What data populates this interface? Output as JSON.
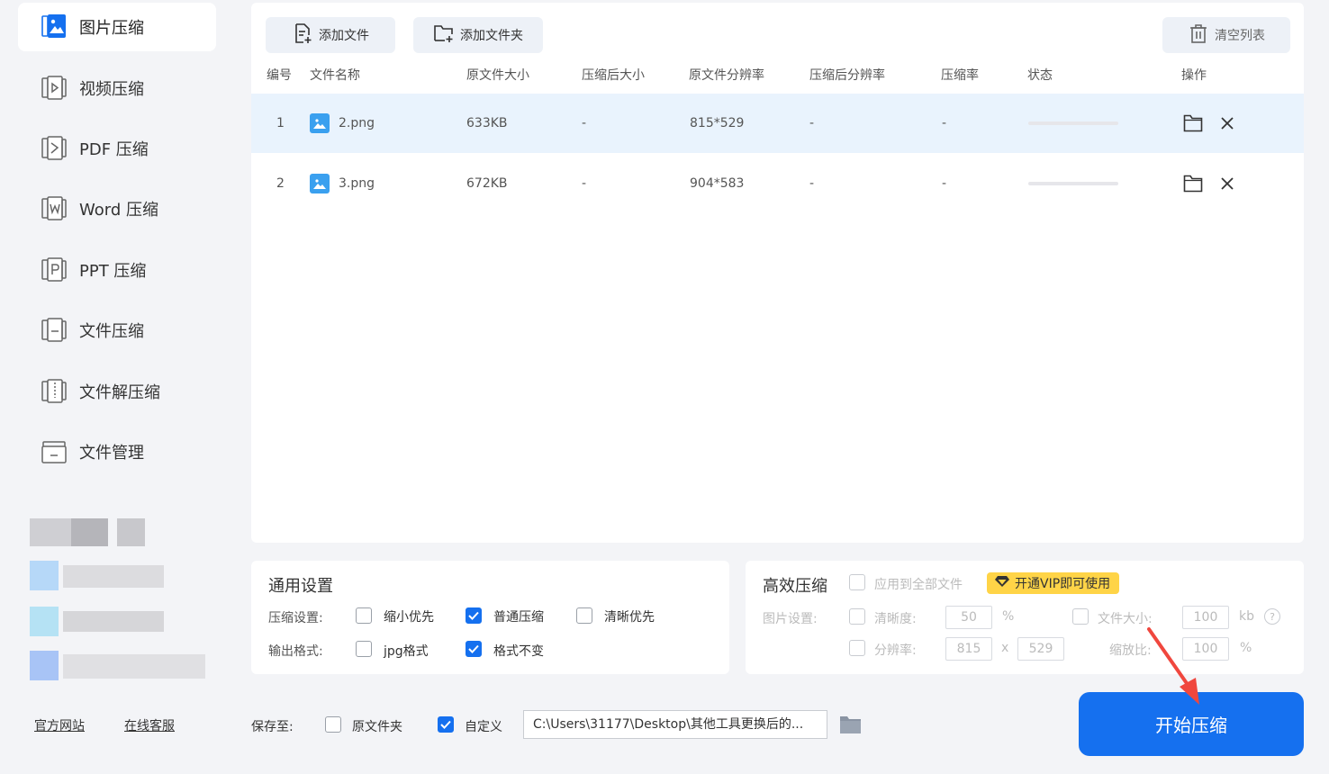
{
  "sidebar": {
    "items": [
      {
        "label": "图片压缩",
        "icon": "image-compress-icon",
        "active": true
      },
      {
        "label": "视频压缩",
        "icon": "video-compress-icon"
      },
      {
        "label": "PDF 压缩",
        "icon": "pdf-compress-icon"
      },
      {
        "label": "Word 压缩",
        "icon": "word-compress-icon"
      },
      {
        "label": "PPT 压缩",
        "icon": "ppt-compress-icon"
      },
      {
        "label": "文件压缩",
        "icon": "file-compress-icon"
      },
      {
        "label": "文件解压缩",
        "icon": "file-decompress-icon"
      },
      {
        "label": "文件管理",
        "icon": "file-manage-icon"
      }
    ],
    "links": {
      "website": "官方网站",
      "support": "在线客服"
    }
  },
  "toolbar": {
    "add_file": "添加文件",
    "add_folder": "添加文件夹",
    "clear_list": "清空列表"
  },
  "table": {
    "headers": {
      "index": "编号",
      "name": "文件名称",
      "orig_size": "原文件大小",
      "new_size": "压缩后大小",
      "orig_res": "原文件分辨率",
      "new_res": "压缩后分辨率",
      "ratio": "压缩率",
      "status": "状态",
      "action": "操作"
    },
    "rows": [
      {
        "index": "1",
        "name": "2.png",
        "orig_size": "633KB",
        "new_size": "-",
        "orig_res": "815*529",
        "new_res": "-",
        "ratio": "-",
        "progress": 0
      },
      {
        "index": "2",
        "name": "3.png",
        "orig_size": "672KB",
        "new_size": "-",
        "orig_res": "904*583",
        "new_res": "-",
        "ratio": "-",
        "progress": 0
      }
    ]
  },
  "general": {
    "title": "通用设置",
    "compress_label": "压缩设置:",
    "compress_options": [
      {
        "label": "缩小优先",
        "checked": false
      },
      {
        "label": "普通压缩",
        "checked": true
      },
      {
        "label": "清晰优先",
        "checked": false
      }
    ],
    "format_label": "输出格式:",
    "format_options": [
      {
        "label": "jpg格式",
        "checked": false
      },
      {
        "label": "格式不变",
        "checked": true
      }
    ]
  },
  "efficient": {
    "title": "高效压缩",
    "apply_all": "应用到全部文件",
    "vip": "开通VIP即可使用",
    "image_label": "图片设置:",
    "clarity_label": "清晰度:",
    "clarity_value": "50",
    "clarity_unit": "%",
    "filesize_label": "文件大小:",
    "filesize_value": "100",
    "filesize_unit": "kb",
    "help": "?",
    "resolution_label": "分辨率:",
    "res_w": "815",
    "res_x": "x",
    "res_h": "529",
    "scale_label": "缩放比:",
    "scale_value": "100",
    "scale_unit": "%"
  },
  "save": {
    "label": "保存至:",
    "orig_folder": "原文件夹",
    "orig_checked": false,
    "custom": "自定义",
    "custom_checked": true,
    "path": "C:\\Users\\31177\\Desktop\\其他工具更换后的..."
  },
  "start_button": "开始压缩",
  "colors": {
    "accent": "#1570ef",
    "vip": "#ffd447",
    "arrow": "#f0473e"
  }
}
